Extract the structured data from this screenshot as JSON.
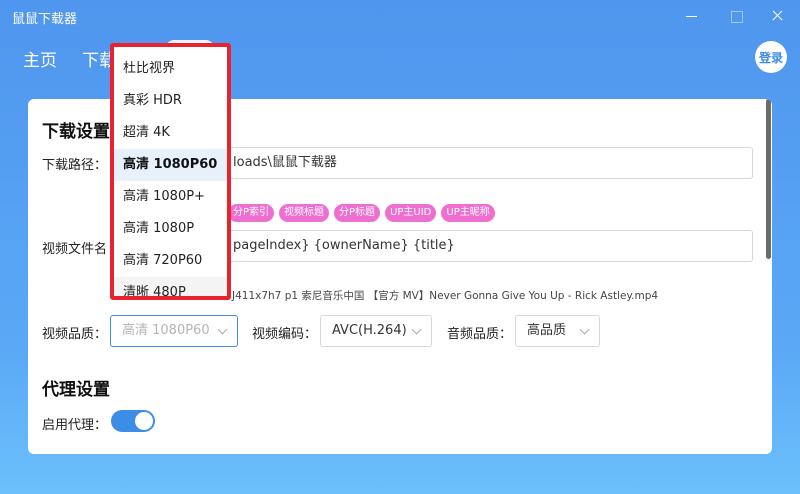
{
  "window": {
    "title": "鼠鼠下载器"
  },
  "nav": {
    "home": "主页",
    "download": "下载"
  },
  "header": {
    "login": "登录"
  },
  "download_settings": {
    "title": "下载设置",
    "path_label": "下载路径：",
    "path_value": "loads\\鼠鼠下载器",
    "filename_label": "视频文件名",
    "tags": [
      "分P索引",
      "视频标题",
      "分P标题",
      "UP主UID",
      "UP主昵称"
    ],
    "filename_value": "pageIndex} {ownerName} {title}",
    "preview": "J411x7h7 p1 索尼音乐中国 【官方 MV】Never Gonna Give You Up - Rick Astley.mp4",
    "quality_label": "视频品质：",
    "quality_value": "高清 1080P60",
    "codec_label": "视频编码：",
    "codec_value": "AVC(H.264)",
    "audio_label": "音频品质：",
    "audio_value": "高品质"
  },
  "proxy_settings": {
    "title": "代理设置",
    "enable_label": "启用代理：",
    "enabled": true
  },
  "quality_dropdown": {
    "options": [
      "杜比视界",
      "真彩 HDR",
      "超清 4K",
      "高清 1080P60",
      "高清 1080P+",
      "高清 1080P",
      "高清 720P60",
      "清晰 480P"
    ],
    "selected": "高清 1080P60"
  },
  "colors": {
    "accent": "#3d8de6",
    "tag": "#ef6fd1",
    "highlight_border": "#e8232d"
  }
}
